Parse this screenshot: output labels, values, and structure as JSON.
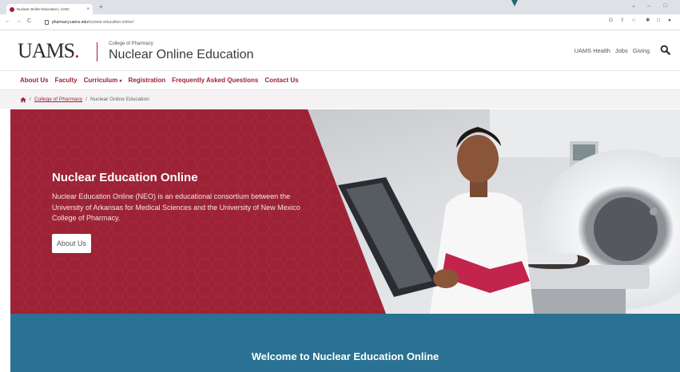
{
  "browser": {
    "tab_title": "Nuclear Online Education | UAM:",
    "tab_close": "×",
    "new_tab": "+",
    "url_host": "pharmacy.uams.edu",
    "url_path": "/nuclear-education-online/",
    "win_min": "⌄",
    "win_dash": "–",
    "win_restore": "□",
    "nav_back": "←",
    "nav_forward": "→",
    "nav_reload": "C",
    "ext_icons": [
      "G",
      "⇪",
      "☆",
      "✱",
      "□",
      "●"
    ]
  },
  "header": {
    "logo": "UAMS",
    "logo_dot": ".",
    "college": "College of Pharmacy",
    "site_name": "Nuclear Online Education",
    "utility_links": [
      "UAMS Health",
      "Jobs",
      "Giving"
    ]
  },
  "nav": {
    "items": [
      "About Us",
      "Faculty",
      "Curriculum",
      "Registration",
      "Frequently Asked Questions",
      "Contact Us"
    ],
    "caret": "▾"
  },
  "breadcrumb": {
    "sep1": "/",
    "link": "College of Pharmacy",
    "sep2": "/",
    "current": "Nuclear Online Education"
  },
  "hero": {
    "title": "Nuclear Education Online",
    "description": "Nuclear Education Online (NEO) is an educational consortium between the University of Arkansas for Medical Sciences and the University of New Mexico College of Pharmacy.",
    "button": "About Us"
  },
  "welcome": {
    "title": "Welcome to Nuclear Education Online"
  },
  "colors": {
    "brand": "#9d2235",
    "welcome_band": "#2a7293"
  }
}
